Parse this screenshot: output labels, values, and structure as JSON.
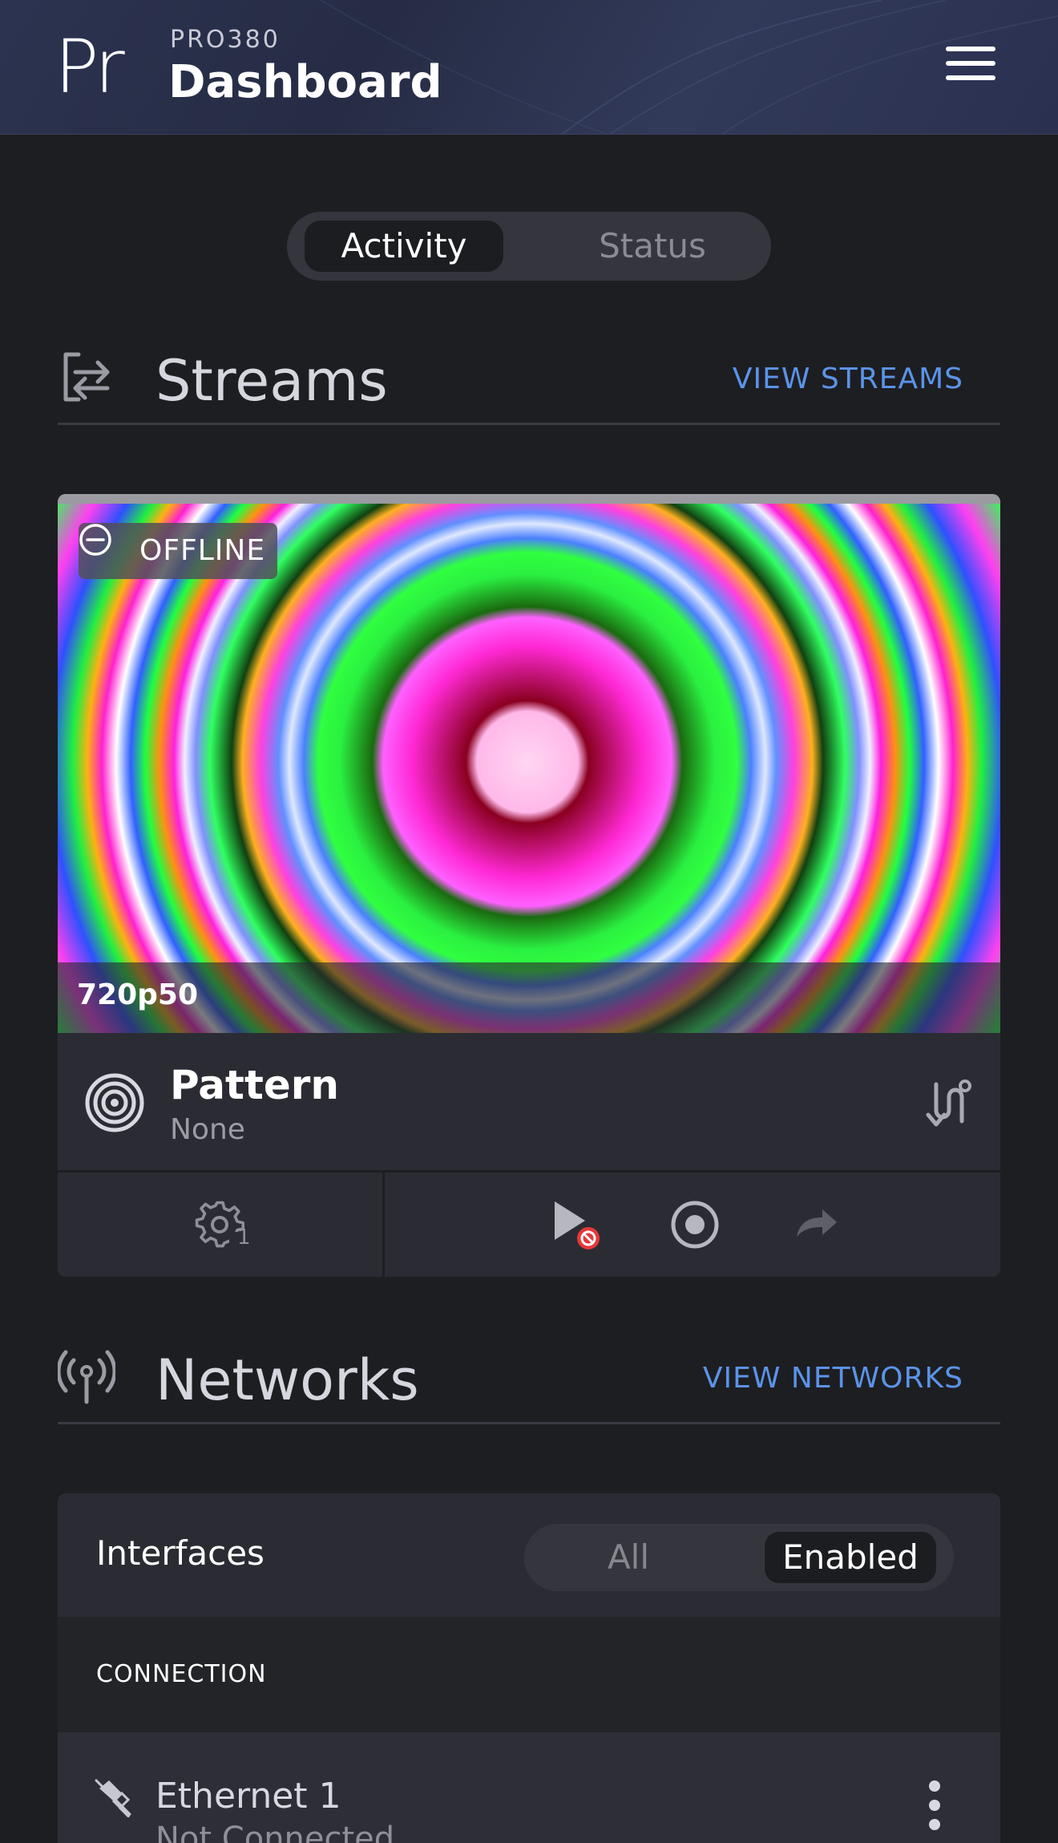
{
  "header": {
    "logo_text": "Pr",
    "device_name": "PRO380",
    "title": "Dashboard",
    "menu_icon": "hamburger-menu-icon"
  },
  "view_tabs": {
    "active": "Activity",
    "inactive": "Status"
  },
  "streams": {
    "title": "Streams",
    "link": "VIEW STREAMS",
    "icon": "streams-transfer-icon",
    "card": {
      "status_badge": "OFFLINE",
      "resolution": "720p50",
      "source_name": "Pattern",
      "source_sub": "None",
      "settings_count": "1",
      "icons": [
        "pattern-target-icon",
        "route-icon",
        "settings-gear-icon",
        "play-disabled-icon",
        "record-icon",
        "share-arrow-icon"
      ],
      "colors": {
        "disabled_badge": "#e5383b",
        "accent_link": "#5b93e8"
      }
    }
  },
  "networks": {
    "title": "Networks",
    "link": "VIEW NETWORKS",
    "icon": "antenna-icon",
    "interfaces_label": "Interfaces",
    "filter": {
      "options": [
        "All",
        "Enabled"
      ],
      "selected": "Enabled"
    },
    "connection_header": "CONNECTION",
    "rows": [
      {
        "name": "Ethernet 1",
        "status": "Not Connected",
        "icon": "ethernet-unplugged-icon"
      }
    ]
  }
}
